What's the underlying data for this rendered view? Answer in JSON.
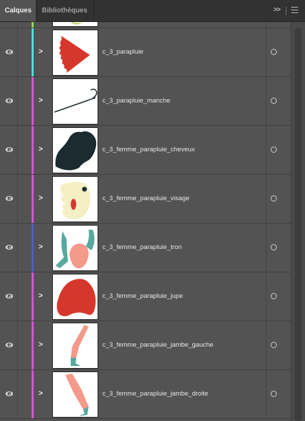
{
  "tabs": [
    {
      "label": "Calques",
      "active": true
    },
    {
      "label": "Bibliothèques",
      "active": false
    }
  ],
  "header": {
    "collapse_icon": "double-chevron-right-icon",
    "menu_icon": "hamburger-menu-icon"
  },
  "colors": {
    "panel_bg": "#535353",
    "tab_bg": "#323232"
  },
  "partial_top_row": {
    "color": "#8be04a"
  },
  "layers": [
    {
      "name": "c_3_parapluie",
      "color": "#3de8e3",
      "thumb": "umbrella"
    },
    {
      "name": "c_3_parapluie_manche",
      "color": "#e24ce6",
      "thumb": "handle"
    },
    {
      "name": "c_3_femme_parapluie_cheveux",
      "color": "#e24ce6",
      "thumb": "hair"
    },
    {
      "name": "c_3_femme_parapluie_visage",
      "color": "#e24ce6",
      "thumb": "face"
    },
    {
      "name": "c_3_femme_parapluie_tron",
      "color": "#4f5bd5",
      "thumb": "torso"
    },
    {
      "name": "c_3_femme_parapluie_jupe",
      "color": "#e24ce6",
      "thumb": "skirt"
    },
    {
      "name": "c_3_femme_parapluie_jambe_gauche",
      "color": "#e24ce6",
      "thumb": "leg-left"
    },
    {
      "name": "c_3_femme_parapluie_jambe_droite",
      "color": "#e24ce6",
      "thumb": "leg-right"
    }
  ]
}
